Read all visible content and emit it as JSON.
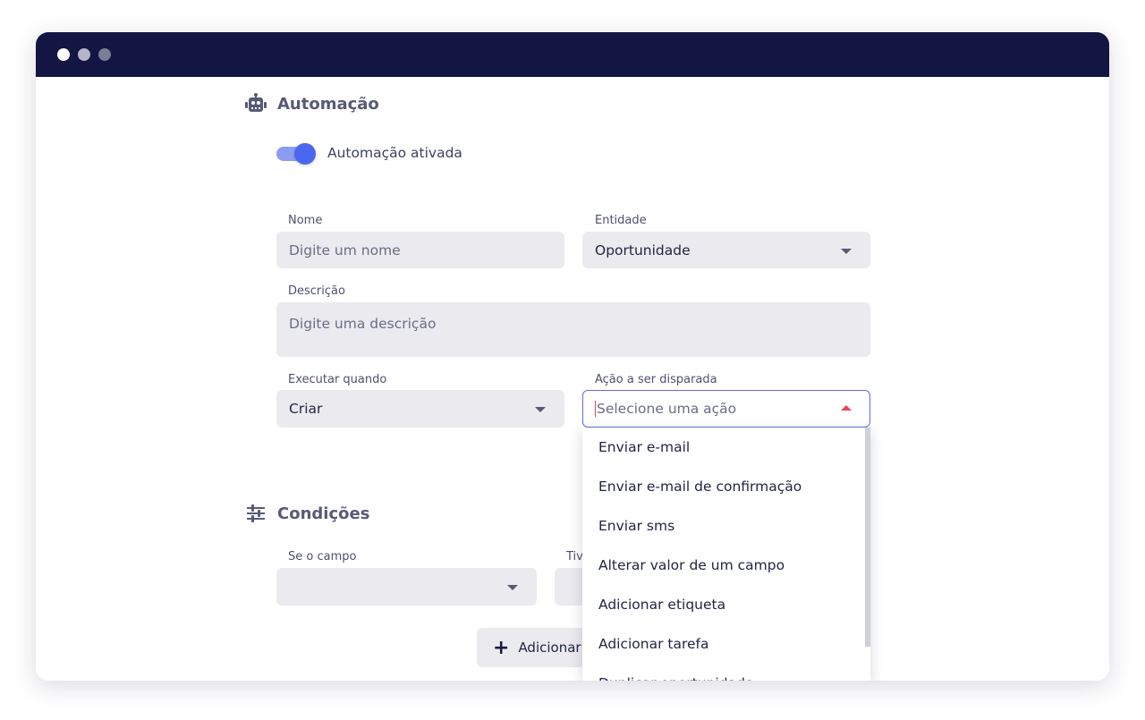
{
  "window": {
    "controls": [
      "close-dot",
      "minimize-dot",
      "maximize-dot"
    ]
  },
  "automation": {
    "icon": "robot-icon",
    "title": "Automação",
    "toggle": {
      "label": "Automação ativada",
      "on": true,
      "color": "#4c67ef"
    },
    "name_label": "Nome",
    "name_placeholder": "Digite um nome",
    "entity_label": "Entidade",
    "entity_value": "Oportunidade",
    "description_label": "Descrição",
    "description_placeholder": "Digite uma descrição",
    "execute_label": "Executar quando",
    "execute_value": "Criar",
    "action_label": "Ação a ser disparada",
    "action_placeholder": "Selecione uma ação"
  },
  "action_dropdown": {
    "options": [
      "Enviar e-mail",
      "Enviar e-mail de confirmação",
      "Enviar sms",
      "Alterar valor de um campo",
      "Adicionar etiqueta",
      "Adicionar tarefa",
      "Duplicar oportunidade"
    ]
  },
  "conditions": {
    "icon": "sliders-icon",
    "title": "Condições",
    "field_label": "Se o campo",
    "type_label": "Tiv",
    "add_button": "Adicionar"
  },
  "colors": {
    "titlebar": "#131542",
    "accent": "#4c67ef",
    "caret_active": "#e04a55",
    "input_bg": "#ebeaef"
  }
}
